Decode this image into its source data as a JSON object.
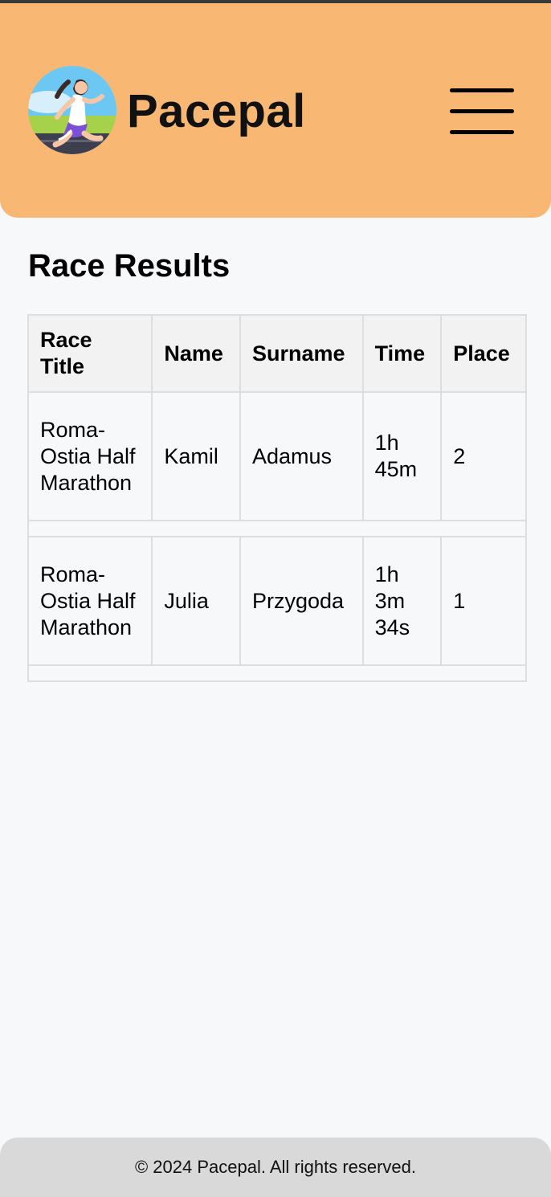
{
  "header": {
    "brand": "Pacepal",
    "logo_icon": "runner-logo-icon",
    "menu_icon": "hamburger-menu-icon",
    "background_color": "#f8b873"
  },
  "main": {
    "title": "Race Results",
    "table": {
      "columns": [
        "Race Title",
        "Name",
        "Surname",
        "Time",
        "Place"
      ],
      "rows": [
        {
          "race_title": "Roma-Ostia Half Marathon",
          "name": "Kamil",
          "surname": "Adamus",
          "time": "1h 45m",
          "place": "2"
        },
        {
          "race_title": "Roma-Ostia Half Marathon",
          "name": "Julia",
          "surname": "Przygoda",
          "time": "1h 3m 34s",
          "place": "1"
        }
      ]
    }
  },
  "footer": {
    "text": "© 2024 Pacepal. All rights reserved."
  }
}
